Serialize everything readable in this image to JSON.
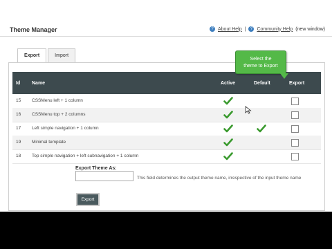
{
  "page_title": "Theme Manager",
  "help": {
    "about": "About Help",
    "community": "Community Help",
    "new_window": "(new window)"
  },
  "tabs": [
    {
      "label": "Export",
      "active": true
    },
    {
      "label": "Import",
      "active": false
    }
  ],
  "table": {
    "headers": {
      "id": "Id",
      "name": "Name",
      "active": "Active",
      "default": "Default",
      "export": "Export"
    },
    "rows": [
      {
        "id": "15",
        "name": "CSSMenu left + 1 column",
        "active": true,
        "default": false
      },
      {
        "id": "16",
        "name": "CSSMenu top + 2 columns",
        "active": true,
        "default": false
      },
      {
        "id": "17",
        "name": "Left simple navigation + 1 column",
        "active": true,
        "default": true
      },
      {
        "id": "19",
        "name": "Minimal template",
        "active": true,
        "default": false
      },
      {
        "id": "18",
        "name": "Top simple navigation + left subnavigation + 1 column",
        "active": true,
        "default": false
      }
    ]
  },
  "export_form": {
    "label": "Export Theme As:",
    "value": "",
    "hint": "This field determines the output theme name, irrespective of the input theme name",
    "button": "Export"
  },
  "callout": {
    "line1": "Select the",
    "line2": "theme to Export"
  },
  "colors": {
    "header_bg": "#3d4a4e",
    "check_green": "#3a9a2e",
    "callout_green": "#54b948"
  }
}
